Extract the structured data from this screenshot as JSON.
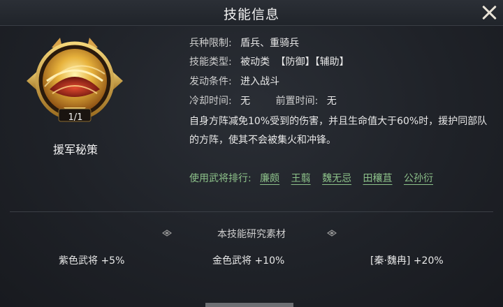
{
  "window": {
    "title": "技能信息"
  },
  "skill": {
    "name": "援军秘策",
    "count": "1/1",
    "unit_limit_label": "兵种限制:",
    "unit_limit_value": "盾兵、重骑兵",
    "type_label": "技能类型:",
    "type_value": "被动类",
    "type_tag_1": "【防御】",
    "type_tag_2": "【辅助】",
    "trigger_label": "发动条件:",
    "trigger_value": "进入战斗",
    "cooldown_label": "冷却时间:",
    "cooldown_value": "无",
    "pre_time_label": "前置时间:",
    "pre_time_value": "无",
    "description": "自身方阵减免10%受到的伤害，并且生命值大于60%时，援护同部队的方阵，使其不会被集火和冲锋。"
  },
  "ranking": {
    "label": "使用武将排行:",
    "generals": [
      "廉颇",
      "王翦",
      "魏无忌",
      "田穰苴",
      "公孙衍"
    ]
  },
  "research": {
    "title": "本技能研究素材",
    "bonuses": [
      {
        "label": "紫色武将 +5%"
      },
      {
        "label": "金色武将 +10%"
      },
      {
        "label": "[秦·魏冉] +20%"
      }
    ]
  },
  "icons": {
    "close": "close-icon",
    "emblem": "skill-emblem-icon",
    "decor": "diamond-ornament-icon"
  },
  "colors": {
    "accent_green": "#8dc28a",
    "emblem_gold": "#d9a441",
    "emblem_red": "#c9362a"
  }
}
